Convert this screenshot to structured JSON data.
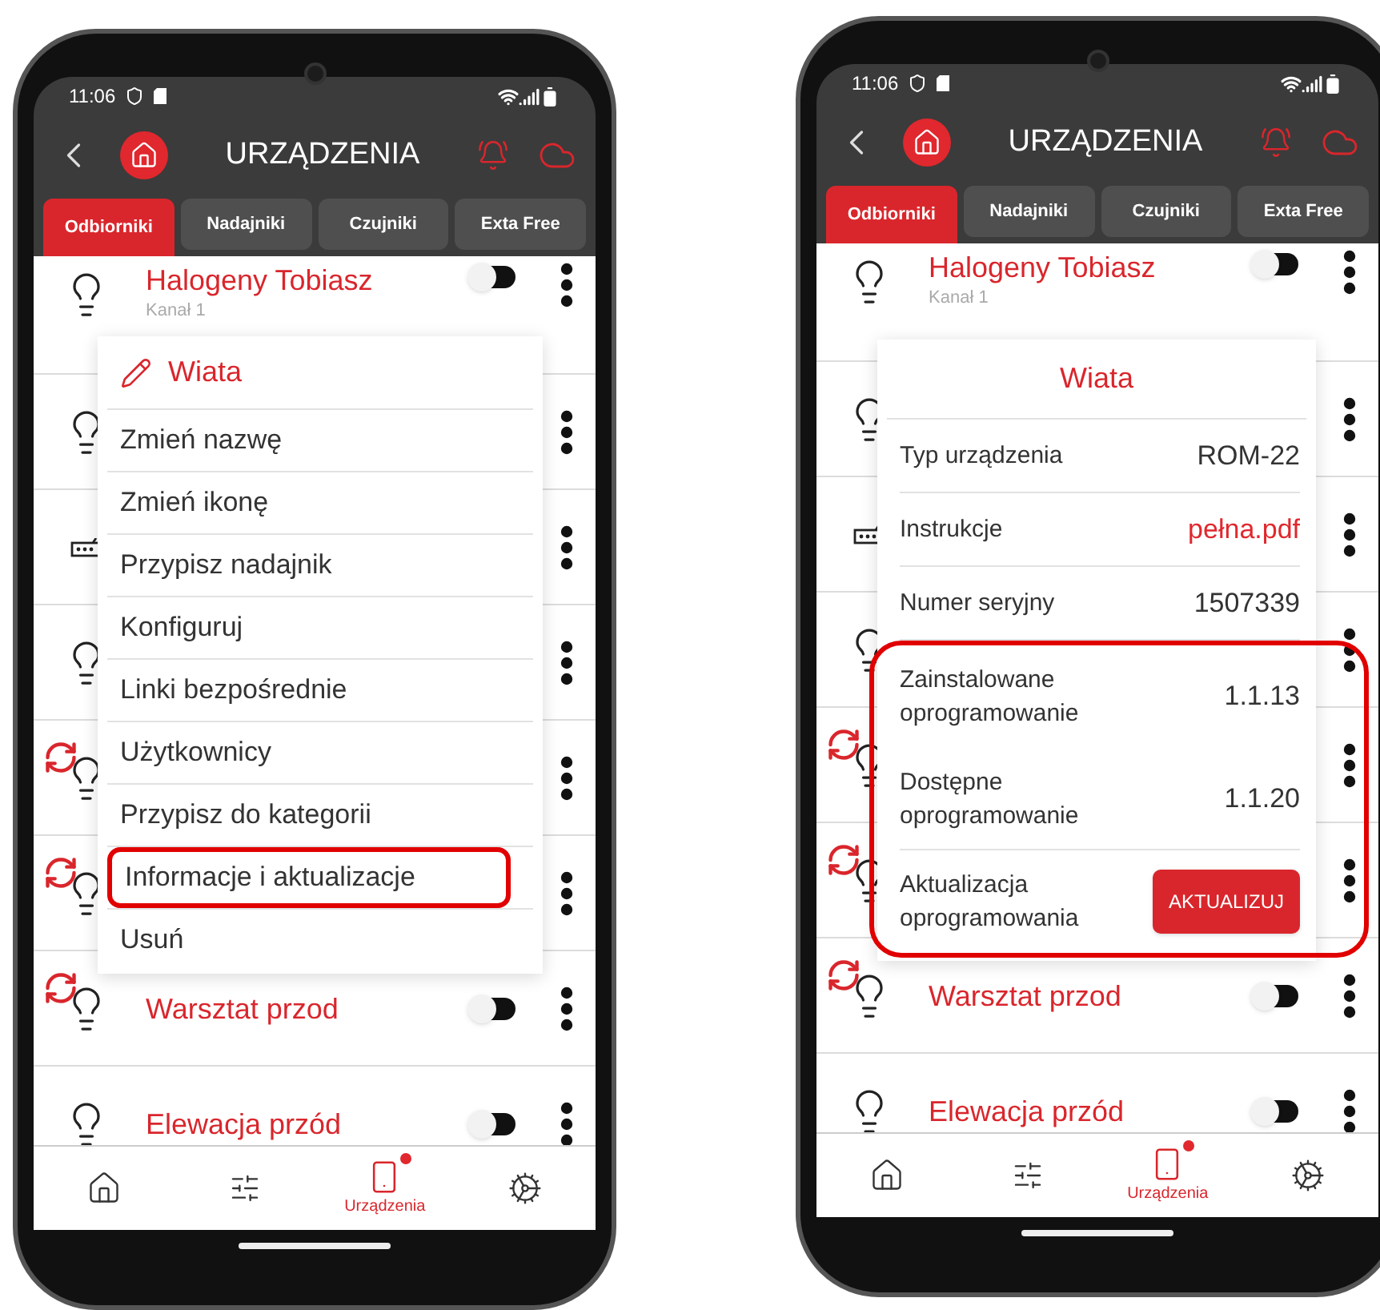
{
  "phones": [
    {
      "status": {
        "time": "11:06"
      },
      "app_bar": {
        "title": "URZĄDZENIA"
      },
      "tabs": [
        {
          "label": "Odbiorniki",
          "selected": true
        },
        {
          "label": "Nadajniki",
          "selected": false
        },
        {
          "label": "Czujniki",
          "selected": false
        },
        {
          "label": "Exta Free",
          "selected": false
        }
      ],
      "devices": [
        {
          "kind": "bulb",
          "sync": false,
          "name": "Halogeny Tobiasz",
          "channel": "Kanał 1",
          "on": false
        },
        {
          "kind": "bulb",
          "sync": false
        },
        {
          "kind": "remote",
          "sync": false
        },
        {
          "kind": "bulb",
          "sync": false
        },
        {
          "kind": "bulb",
          "sync": true
        },
        {
          "kind": "bulb",
          "sync": true
        },
        {
          "kind": "bulb",
          "sync": true,
          "name": "Warsztat przod",
          "on": false
        },
        {
          "kind": "bulb",
          "sync": false,
          "name": "Elewacja przód",
          "on": false
        }
      ],
      "popup": {
        "kind": "menu",
        "title": "Wiata",
        "items": [
          {
            "label": "Zmień nazwę",
            "highlighted": false
          },
          {
            "label": "Zmień ikonę",
            "highlighted": false
          },
          {
            "label": "Przypisz nadajnik",
            "highlighted": false
          },
          {
            "label": "Konfiguruj",
            "highlighted": false
          },
          {
            "label": "Linki bezpośrednie",
            "highlighted": false
          },
          {
            "label": "Użytkownicy",
            "highlighted": false
          },
          {
            "label": "Przypisz do kategorii",
            "highlighted": false
          },
          {
            "label": "Informacje i aktualizacje",
            "highlighted": true
          },
          {
            "label": "Usuń",
            "highlighted": false
          }
        ]
      },
      "nav": [
        {
          "kind": "house",
          "selected": false,
          "badge": false
        },
        {
          "kind": "remote",
          "selected": false,
          "badge": false
        },
        {
          "kind": "device",
          "label": "Urządzenia",
          "selected": true,
          "badge": true
        },
        {
          "kind": "gears",
          "selected": false,
          "badge": false
        }
      ]
    },
    {
      "status": {
        "time": "11:06"
      },
      "app_bar": {
        "title": "URZĄDZENIA"
      },
      "tabs": [
        {
          "label": "Odbiorniki",
          "selected": true
        },
        {
          "label": "Nadajniki",
          "selected": false
        },
        {
          "label": "Czujniki",
          "selected": false
        },
        {
          "label": "Exta Free",
          "selected": false
        }
      ],
      "devices": [
        {
          "kind": "bulb",
          "sync": false,
          "name": "Halogeny Tobiasz",
          "channel": "Kanał 1",
          "on": false
        },
        {
          "kind": "bulb",
          "sync": false
        },
        {
          "kind": "remote",
          "sync": false
        },
        {
          "kind": "bulb",
          "sync": false
        },
        {
          "kind": "bulb",
          "sync": true
        },
        {
          "kind": "bulb",
          "sync": true
        },
        {
          "kind": "bulb",
          "sync": true,
          "name": "Warsztat przod",
          "on": false
        },
        {
          "kind": "bulb",
          "sync": false,
          "name": "Elewacja przód",
          "on": false
        }
      ],
      "popup": {
        "kind": "info",
        "title": "Wiata",
        "rows": [
          {
            "label": "Typ urządzenia",
            "value": "ROM-22",
            "kind": "text",
            "highlighted": false
          },
          {
            "label": "Instrukcje",
            "value": "pełna.pdf",
            "kind": "link",
            "highlighted": false
          },
          {
            "label": "Numer seryjny",
            "value": "1507339",
            "kind": "text",
            "highlighted": false
          },
          {
            "label": "Zainstalowane oprogramowanie",
            "value": "1.1.13",
            "kind": "text",
            "highlighted": true
          },
          {
            "label": "Dostępne oprogramowanie",
            "value": "1.1.20",
            "kind": "text",
            "highlighted": true
          },
          {
            "label": "Aktualizacja oprogramowania",
            "value": "AKTUALIZUJ",
            "kind": "button",
            "highlighted": true
          }
        ]
      },
      "nav": [
        {
          "kind": "house",
          "selected": false,
          "badge": false
        },
        {
          "kind": "remote",
          "selected": false,
          "badge": false
        },
        {
          "kind": "device",
          "label": "Urządzenia",
          "selected": true,
          "badge": true
        },
        {
          "kind": "gears",
          "selected": false,
          "badge": false
        }
      ]
    }
  ]
}
